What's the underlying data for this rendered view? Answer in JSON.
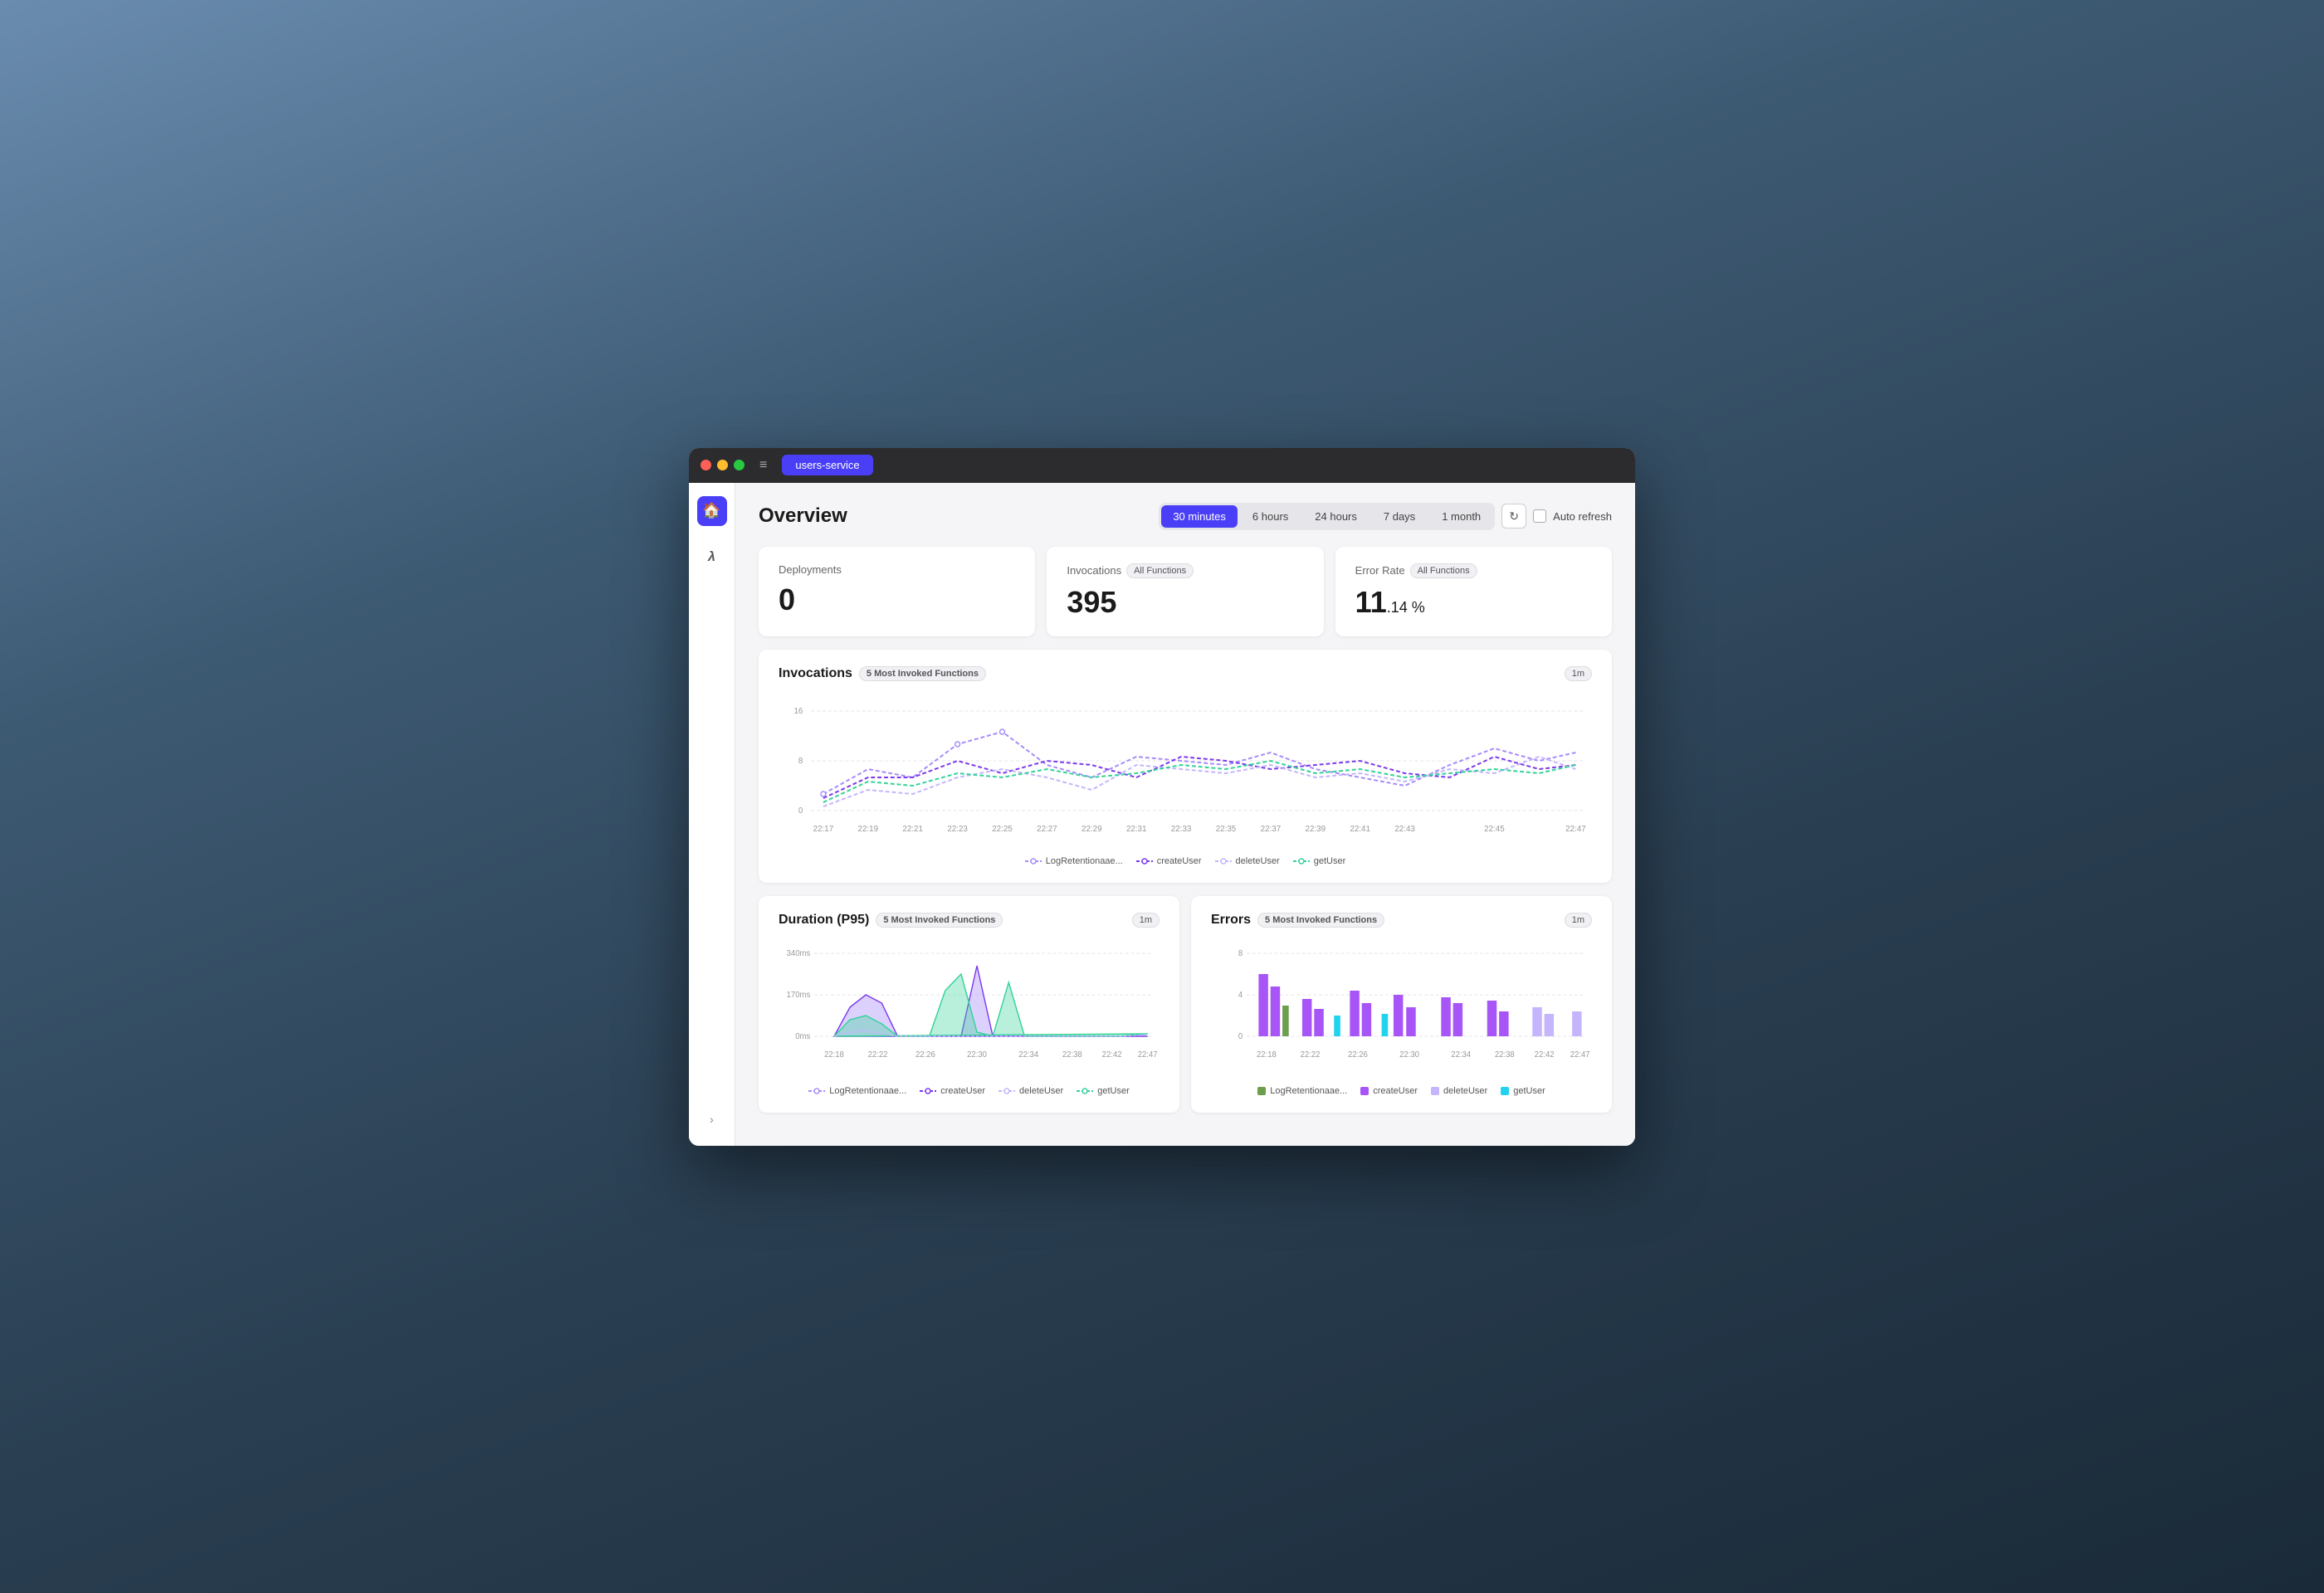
{
  "window": {
    "title": "users-service"
  },
  "sidebar": {
    "home_icon": "🏠",
    "lambda_icon": "λ",
    "chevron": ">"
  },
  "header": {
    "title": "Overview",
    "time_buttons": [
      {
        "label": "30 minutes",
        "active": true
      },
      {
        "label": "6 hours",
        "active": false
      },
      {
        "label": "24 hours",
        "active": false
      },
      {
        "label": "7 days",
        "active": false
      },
      {
        "label": "1 month",
        "active": false
      }
    ],
    "auto_refresh_label": "Auto refresh"
  },
  "stat_cards": [
    {
      "label": "Deployments",
      "value": "0",
      "badge": null
    },
    {
      "label": "Invocations",
      "value": "395",
      "badge": "All Functions"
    },
    {
      "label": "Error Rate",
      "value": "11",
      "value_small": ".14 %",
      "badge": "All Functions"
    }
  ],
  "invocations_chart": {
    "title": "Invocations",
    "badge": "5 Most Invoked Functions",
    "interval": "1m",
    "x_labels": [
      "22:17",
      "22:19",
      "22:21",
      "22:23",
      "22:25",
      "22:27",
      "22:29",
      "22:31",
      "22:33",
      "22:35",
      "22:37",
      "22:39",
      "22:41",
      "22:43",
      "22:45",
      "22:47"
    ],
    "y_labels": [
      "0",
      "8",
      "16"
    ],
    "legend": [
      {
        "label": "LogRetentionaae...",
        "color": "#a78bfa",
        "style": "dashed-circle"
      },
      {
        "label": "createUser",
        "color": "#7c3aed",
        "style": "dashed-circle"
      },
      {
        "label": "deleteUser",
        "color": "#c4b5fd",
        "style": "dashed-circle"
      },
      {
        "label": "getUser",
        "color": "#34d399",
        "style": "dashed-circle"
      }
    ]
  },
  "duration_chart": {
    "title": "Duration (P95)",
    "badge": "5 Most Invoked Functions",
    "interval": "1m",
    "x_labels": [
      "22:18",
      "22:22",
      "22:26",
      "22:30",
      "22:34",
      "22:38",
      "22:42",
      "22:47"
    ],
    "y_labels": [
      "0ms",
      "170ms",
      "340ms"
    ],
    "legend": [
      {
        "label": "LogRetentionaae...",
        "color": "#a78bfa"
      },
      {
        "label": "createUser",
        "color": "#7c3aed"
      },
      {
        "label": "deleteUser",
        "color": "#c4b5fd"
      },
      {
        "label": "getUser",
        "color": "#34d399"
      }
    ]
  },
  "errors_chart": {
    "title": "Errors",
    "badge": "5 Most Invoked Functions",
    "interval": "1m",
    "x_labels": [
      "22:18",
      "22:22",
      "22:26",
      "22:30",
      "22:34",
      "22:38",
      "22:42",
      "22:47"
    ],
    "y_labels": [
      "0",
      "4",
      "8"
    ],
    "legend": [
      {
        "label": "LogRetentionaae...",
        "color": "#6d9e4e"
      },
      {
        "label": "createUser",
        "color": "#a855f7"
      },
      {
        "label": "deleteUser",
        "color": "#c4b5fd"
      },
      {
        "label": "getUser",
        "color": "#22d3ee"
      }
    ]
  }
}
